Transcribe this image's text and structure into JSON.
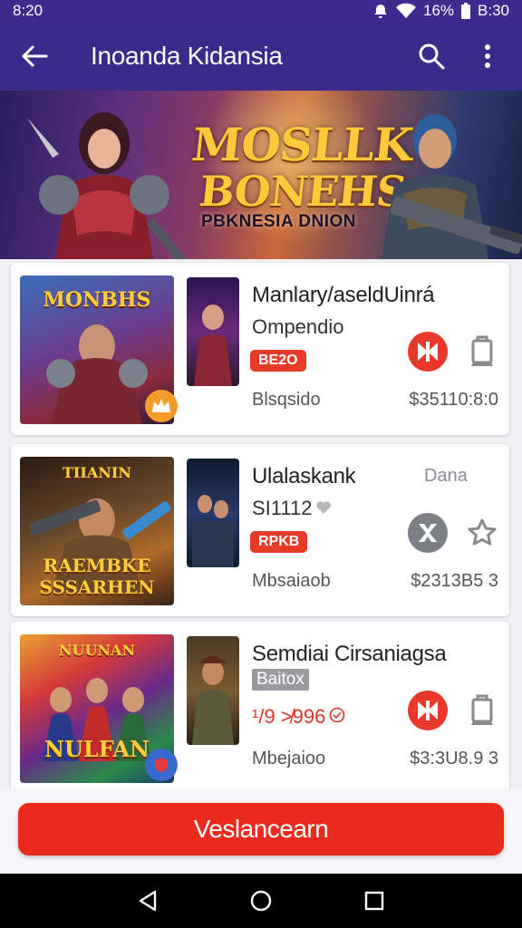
{
  "status_bar": {
    "time_left": "8:20",
    "battery_percent": "16%",
    "time_right": "B:30",
    "icons": [
      "notification-icon",
      "wifi-icon",
      "battery-icon"
    ]
  },
  "app_bar": {
    "title": "Inoanda Kidansia",
    "icons": [
      "back-arrow-icon",
      "search-icon",
      "more-vert-icon"
    ]
  },
  "banner": {
    "logo_line1": "MOSLLK",
    "logo_line2": "BONEHS",
    "tagline": "PBKNESIA DNION"
  },
  "games": [
    {
      "cover_title": "MONBHS",
      "name": "Manlary/aseldUinrá",
      "sub": "Ompendio",
      "badge": "BE2O",
      "meta": "Blsqsido",
      "price": "$35110:8:0",
      "action_icon": "gift-icon",
      "secondary_icon": "bookmark-icon",
      "has_corner_badge": true
    },
    {
      "cover_title": "RAEMBKE SSSARHEN",
      "name": "Ulalaskank",
      "sub": "SI1112",
      "tag_right": "Dana",
      "badge": "RPKB",
      "meta": "Mbsaiaob",
      "price": "$2313B5 3",
      "action_icon": "close-x-icon",
      "secondary_icon": "star-outline-icon",
      "has_corner_badge": false
    },
    {
      "cover_title": "NULFAN",
      "name": "Semdiai Cirsaniagsa",
      "sub": "Baitox",
      "price_highlight": "¹/9 ≯996",
      "meta": "Mbejaioo",
      "price": "$3:3U8.9 3",
      "action_icon": "gift-icon",
      "secondary_icon": "bookmark-icon",
      "has_corner_badge": true
    }
  ],
  "cta": {
    "label": "Veslancearn"
  },
  "nav_bar": {
    "icons": [
      "nav-back-icon",
      "nav-home-icon",
      "nav-recents-icon"
    ]
  },
  "colors": {
    "app_bar": "#3a2a8a",
    "accent_red": "#ea2a1c",
    "badge_red": "#e63b26",
    "gold": "#ffc93a"
  }
}
